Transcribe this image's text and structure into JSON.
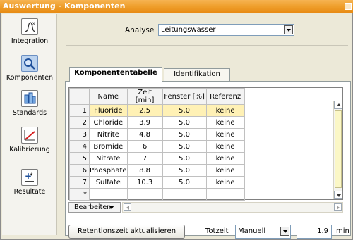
{
  "window": {
    "title": "Auswertung - Komponenten"
  },
  "sidebar": {
    "items": [
      {
        "label": "Integration",
        "icon": "integration-icon"
      },
      {
        "label": "Komponenten",
        "icon": "components-icon"
      },
      {
        "label": "Standards",
        "icon": "standards-icon"
      },
      {
        "label": "Kalibrierung",
        "icon": "calibration-icon"
      },
      {
        "label": "Resultate",
        "icon": "results-icon"
      }
    ],
    "active": "Komponenten"
  },
  "analysis": {
    "label": "Analyse",
    "value": "Leitungswasser"
  },
  "tabs": [
    {
      "label": "Komponententabelle",
      "active": true
    },
    {
      "label": "Identifikation",
      "active": false
    }
  ],
  "table": {
    "columns": [
      "Name",
      "Zeit [min]",
      "Fenster [%]",
      "Referenz"
    ],
    "rows": [
      {
        "index": "1",
        "name": "Fluoride",
        "time": "2.5",
        "window": "5.0",
        "reference": "keine"
      },
      {
        "index": "2",
        "name": "Chloride",
        "time": "3.9",
        "window": "5.0",
        "reference": "keine"
      },
      {
        "index": "3",
        "name": "Nitrite",
        "time": "4.8",
        "window": "5.0",
        "reference": "keine"
      },
      {
        "index": "4",
        "name": "Bromide",
        "time": "6",
        "window": "5.0",
        "reference": "keine"
      },
      {
        "index": "5",
        "name": "Nitrate",
        "time": "7",
        "window": "5.0",
        "reference": "keine"
      },
      {
        "index": "6",
        "name": "Phosphate",
        "time": "8.8",
        "window": "5.0",
        "reference": "keine"
      },
      {
        "index": "7",
        "name": "Sulfate",
        "time": "10.3",
        "window": "5.0",
        "reference": "keine"
      }
    ],
    "new_row_marker": "*",
    "selected_row": "1"
  },
  "edit_menu": {
    "label": "Bearbeiten"
  },
  "update_button": {
    "label": "Retentionszeit aktualisieren"
  },
  "total_time": {
    "label": "Totzeit",
    "mode": "Manuell",
    "value": "1.9",
    "unit": "min"
  },
  "colors": {
    "titlebar": "#ef9f2c",
    "selected_row": "#fff1b5",
    "accent_scroll": "#fbf7c6"
  }
}
